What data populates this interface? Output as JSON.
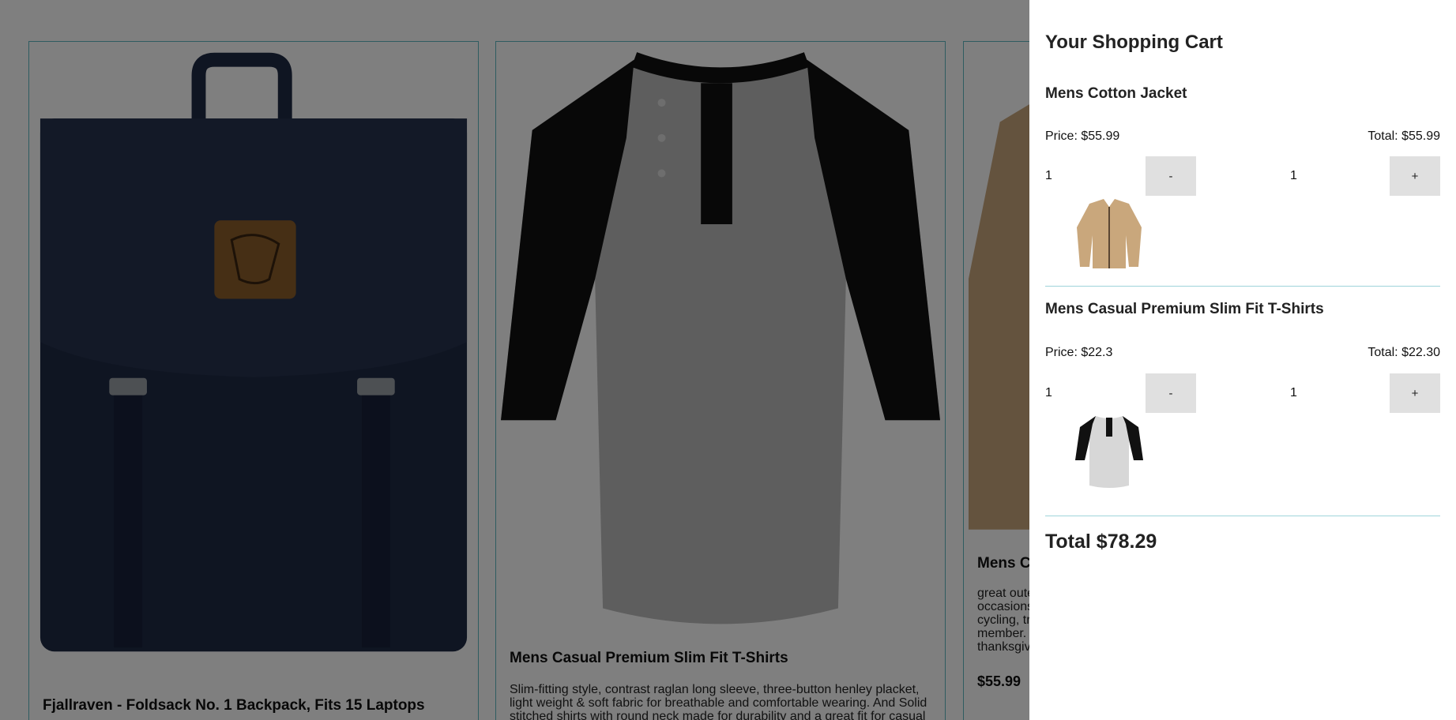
{
  "products": [
    {
      "title": "Fjallraven - Foldsack No. 1 Backpack, Fits 15 Laptops",
      "image_icon": "backpack-image"
    },
    {
      "title": "Mens Casual Premium Slim Fit T-Shirts",
      "description": "Slim-fitting style, contrast raglan long sleeve, three-button henley placket, light weight & soft fabric for breathable and comfortable wearing. And Solid stitched shirts with round neck made for durability and a great fit for casual",
      "image_icon": "raglan-tshirt-image"
    },
    {
      "title_partial": "Mens C",
      "description_lines": [
        "great oute",
        "occasions",
        "cycling, tr",
        "member.",
        "thanksgiv"
      ],
      "price": "$55.99",
      "image_icon": "jacket-image"
    }
  ],
  "cart": {
    "title": "Your Shopping Cart",
    "items": [
      {
        "name": "Mens Cotton Jacket",
        "price_label": "Price: $55.99",
        "total_label": "Total: $55.99",
        "qty_left": "1",
        "qty_right": "1",
        "minus_label": "-",
        "plus_label": "+",
        "thumb_icon": "jacket-thumbnail"
      },
      {
        "name": "Mens Casual Premium Slim Fit T-Shirts",
        "price_label": "Price: $22.3",
        "total_label": "Total: $22.30",
        "qty_left": "1",
        "qty_right": "1",
        "minus_label": "-",
        "plus_label": "+",
        "thumb_icon": "tshirt-thumbnail"
      }
    ],
    "grand_total": "Total $78.29"
  },
  "colors": {
    "overlay": "rgba(0,0,0,0.5)",
    "card_border": "#5fb8c2",
    "button_bg": "#e0e0e0",
    "backpack": "#1f2a44",
    "shirt_body": "#bdbdbd",
    "shirt_sleeve": "#111111",
    "jacket": "#c9a77c"
  }
}
